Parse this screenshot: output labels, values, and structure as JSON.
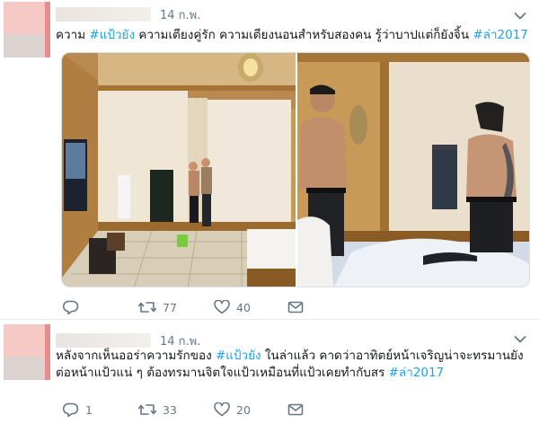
{
  "tweets": [
    {
      "handle": "",
      "time": "14 ก.พ.",
      "text_parts": [
        "ความ ",
        "#แป้วยัง",
        " ความเตียงคู่รัก ความเตียงนอนสำหรับสองคน รู้ว่าบาปแต่ก็ยังจิ้น ",
        "#ล่า2017"
      ],
      "actions": {
        "reply_count": "",
        "retweet_count": "77",
        "like_count": "40"
      }
    },
    {
      "handle": "",
      "time": "14 ก.พ.",
      "line1_parts": [
        "หลังจากเห็นออร่าความรักของ ",
        "#แป้วยัง",
        " ในล่าแล้ว คาดว่าอาทิตย์หน้าเจริญน่าจะทรมานยัง"
      ],
      "line2_parts": [
        "ต่อหน้าแป้วแน่ ๆ ต้องทรมานจิตใจแป้วเหมือนที่แป้วเคยทำกับสร ",
        "#ล่า2017"
      ],
      "actions": {
        "reply_count": "1",
        "retweet_count": "33",
        "like_count": "20"
      }
    }
  ],
  "icons": {
    "caret": "chevron-down-icon",
    "reply": "reply-icon",
    "retweet": "retweet-icon",
    "like": "heart-icon",
    "dm": "envelope-icon"
  },
  "colors": {
    "hashtag": "#1da1f2",
    "meta": "#657786",
    "text": "#14171a"
  }
}
